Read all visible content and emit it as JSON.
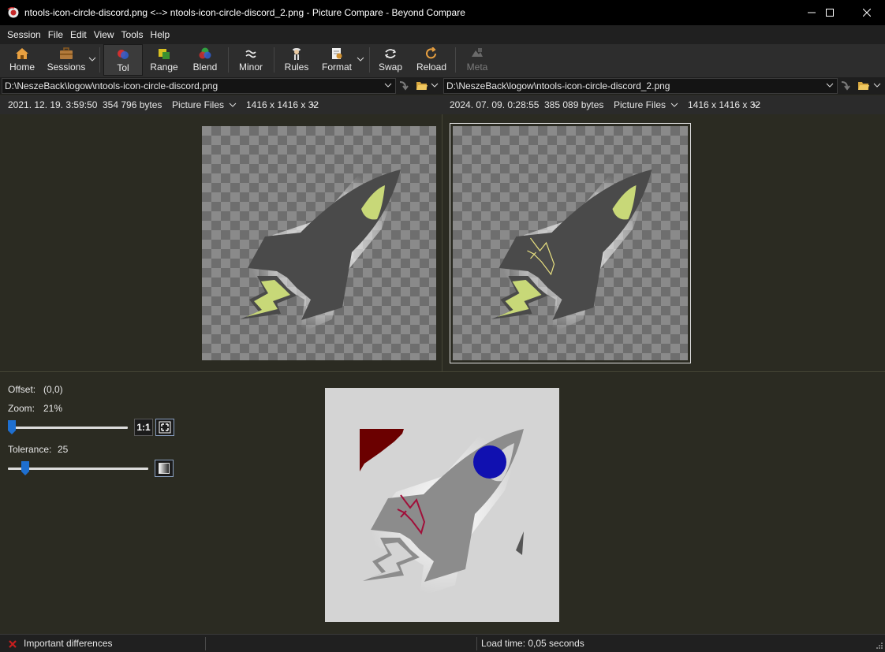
{
  "window": {
    "title": "ntools-icon-circle-discord.png <--> ntools-icon-circle-discord_2.png - Picture Compare - Beyond Compare",
    "minimize_icon": "minimize-icon",
    "maximize_icon": "maximize-icon",
    "close_icon": "close-icon"
  },
  "menu": [
    "Session",
    "File",
    "Edit",
    "View",
    "Tools",
    "Help"
  ],
  "toolbar": {
    "home": "Home",
    "sessions": "Sessions",
    "tol": "Tol",
    "range": "Range",
    "blend": "Blend",
    "minor": "Minor",
    "rules": "Rules",
    "format": "Format",
    "swap": "Swap",
    "reload": "Reload",
    "meta": "Meta"
  },
  "left": {
    "path": "D:\\NeszeBack\\logow\\ntools-icon-circle-discord.png",
    "date": "2021. 12. 19. 3:59:50",
    "size": "354 796 bytes",
    "format": "Picture Files",
    "dimensions": "1416 x 1416 x 32"
  },
  "right": {
    "path": "D:\\NeszeBack\\logow\\ntools-icon-circle-discord_2.png",
    "date": "2024. 07. 09. 0:28:55",
    "size": "385 089 bytes",
    "format": "Picture Files",
    "dimensions": "1416 x 1416 x 32"
  },
  "controls": {
    "offset_label": "Offset:",
    "offset_value": "(0,0)",
    "zoom_label": "Zoom:",
    "zoom_value": "21%",
    "zoom_fraction": 0.0,
    "one_to_one": "1:1",
    "tolerance_label": "Tolerance:",
    "tolerance_value": "25",
    "tolerance_fraction": 0.1
  },
  "status": {
    "differences": "Important differences",
    "load_time": "Load time: 0,05 seconds"
  },
  "colors": {
    "accent": "#1e6fd0",
    "diff_red": "#c81e1e",
    "rocket_green": "#c8d878"
  }
}
